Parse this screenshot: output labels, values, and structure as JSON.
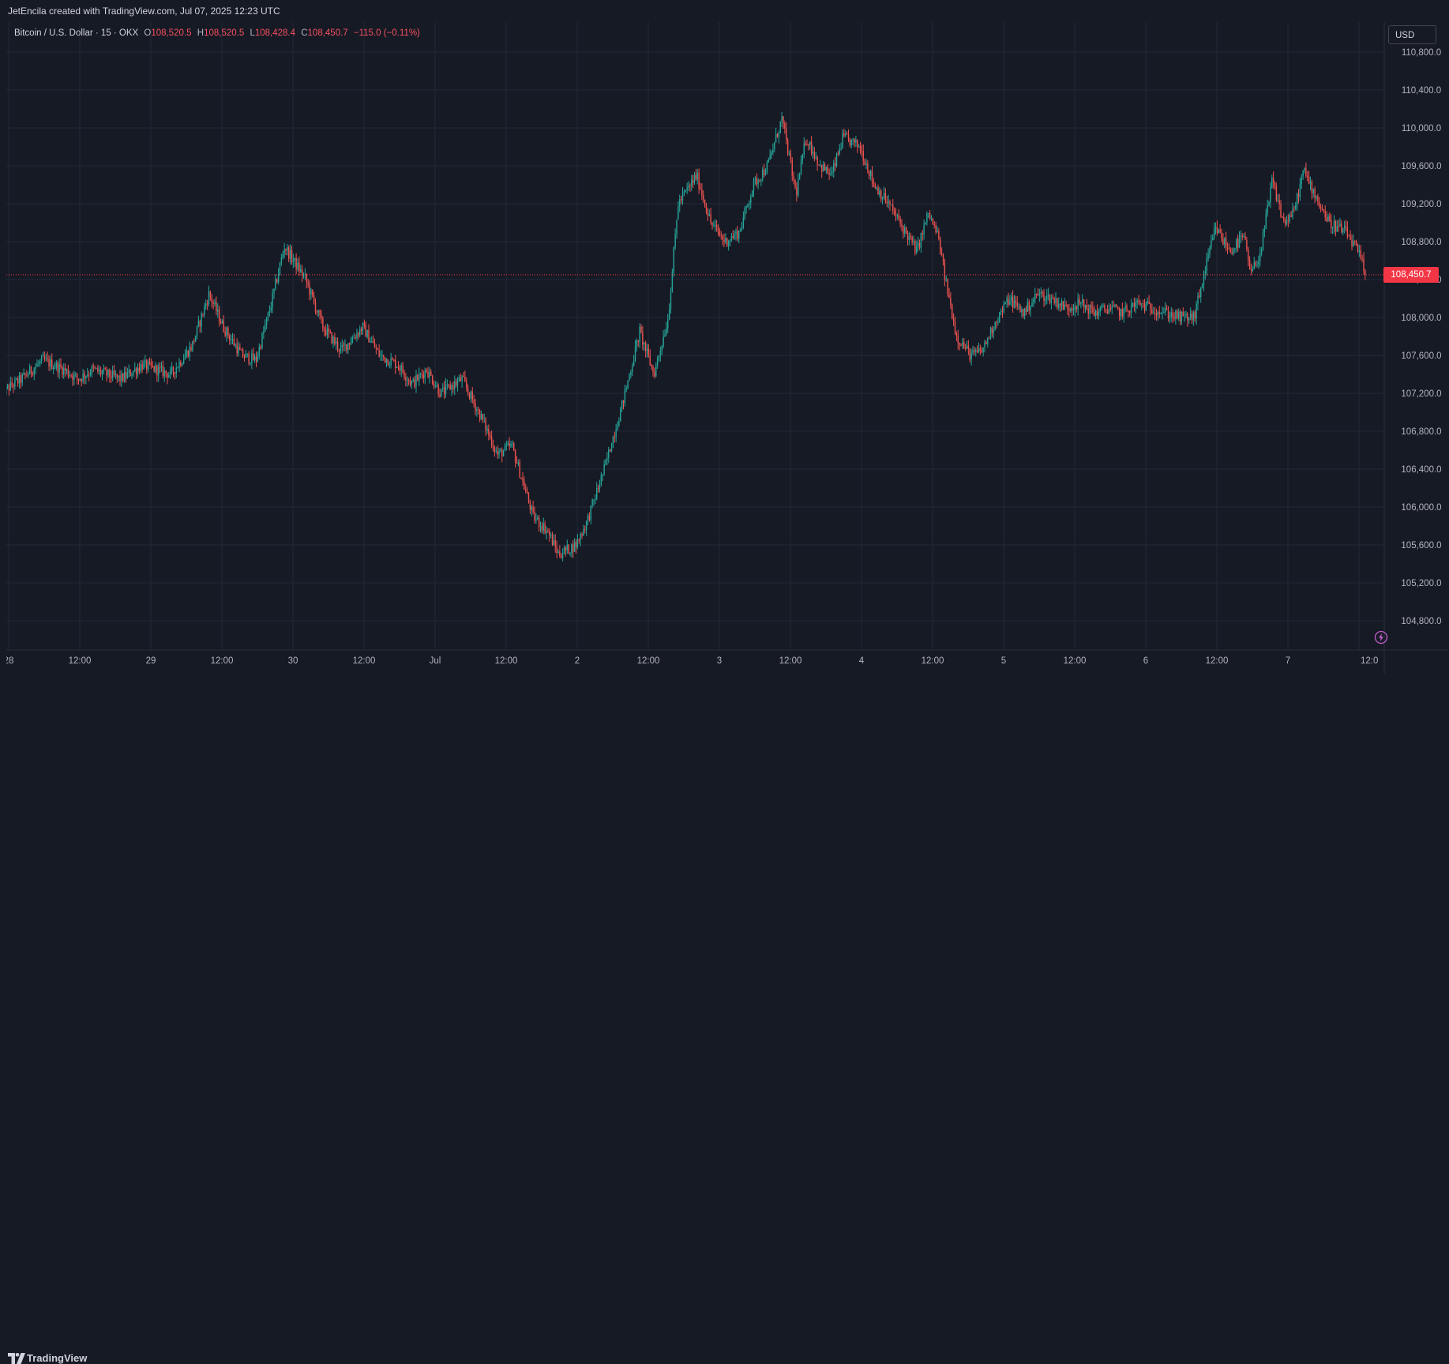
{
  "header": {
    "credit": "JetEncila created with TradingView.com, Jul 07, 2025 12:23 UTC"
  },
  "legend": {
    "symbol": "Bitcoin / U.S. Dollar · 15 · OKX",
    "open_label": "O",
    "open": "108,520.5",
    "high_label": "H",
    "high": "108,520.5",
    "low_label": "L",
    "low": "108,428.4",
    "close_label": "C",
    "close": "108,450.7",
    "change": "−115.0 (−0.11%)"
  },
  "currency": "USD",
  "last_price_label": "108,450.7",
  "footer": {
    "brand": "TradingView"
  },
  "colors": {
    "background": "#161a25",
    "up": "#26a69a",
    "down": "#ef5350",
    "grid": "#232838",
    "price_line": "#f23645",
    "text": "#b2b5be"
  },
  "icons": {
    "alert": "lightning-bolt-icon",
    "logo": "tradingview-logo-icon"
  },
  "chart_data": {
    "type": "candlestick",
    "title": "Bitcoin / U.S. Dollar · 15 · OKX",
    "currency": "USD",
    "last_price": 108450.7,
    "ylim": [
      104600,
      111200
    ],
    "y_ticks": [
      104800,
      105200,
      105600,
      106000,
      106400,
      106800,
      107200,
      107600,
      108000,
      108400,
      108800,
      109200,
      109600,
      110000,
      110400,
      110800
    ],
    "x_ticks": [
      "28",
      "12:00",
      "29",
      "12:00",
      "30",
      "12:00",
      "Jul",
      "12:00",
      "2",
      "12:00",
      "3",
      "12:00",
      "4",
      "12:00",
      "5",
      "12:00",
      "6",
      "12:00",
      "7",
      "12:0"
    ],
    "x_tick_pos": [
      0,
      0.5,
      1,
      1.5,
      2,
      2.5,
      3,
      3.5,
      4,
      4.5,
      5,
      5.5,
      6,
      6.5,
      7,
      7.5,
      8,
      8.5,
      9,
      9.5
    ],
    "bar_interval_minutes": 15,
    "grid": true,
    "path": [
      [
        -0.05,
        107200
      ],
      [
        0.1,
        107350
      ],
      [
        0.25,
        107550
      ],
      [
        0.4,
        107450
      ],
      [
        0.5,
        107350
      ],
      [
        0.6,
        107450
      ],
      [
        0.8,
        107350
      ],
      [
        0.95,
        107500
      ],
      [
        1.15,
        107400
      ],
      [
        1.3,
        107700
      ],
      [
        1.42,
        108250
      ],
      [
        1.52,
        107900
      ],
      [
        1.65,
        107600
      ],
      [
        1.75,
        107550
      ],
      [
        1.85,
        108100
      ],
      [
        1.95,
        108750
      ],
      [
        2.1,
        108400
      ],
      [
        2.22,
        107900
      ],
      [
        2.35,
        107650
      ],
      [
        2.5,
        107900
      ],
      [
        2.62,
        107600
      ],
      [
        2.75,
        107500
      ],
      [
        2.85,
        107300
      ],
      [
        2.95,
        107450
      ],
      [
        3.05,
        107200
      ],
      [
        3.2,
        107350
      ],
      [
        3.35,
        106900
      ],
      [
        3.45,
        106550
      ],
      [
        3.55,
        106650
      ],
      [
        3.62,
        106300
      ],
      [
        3.7,
        105900
      ],
      [
        3.8,
        105750
      ],
      [
        3.88,
        105500
      ],
      [
        4.0,
        105600
      ],
      [
        4.08,
        105850
      ],
      [
        4.2,
        106400
      ],
      [
        4.33,
        107100
      ],
      [
        4.45,
        107850
      ],
      [
        4.55,
        107400
      ],
      [
        4.65,
        108000
      ],
      [
        4.72,
        109200
      ],
      [
        4.85,
        109500
      ],
      [
        4.95,
        109000
      ],
      [
        5.05,
        108800
      ],
      [
        5.15,
        108900
      ],
      [
        5.25,
        109400
      ],
      [
        5.35,
        109600
      ],
      [
        5.45,
        110100
      ],
      [
        5.55,
        109300
      ],
      [
        5.62,
        109900
      ],
      [
        5.72,
        109600
      ],
      [
        5.8,
        109500
      ],
      [
        5.88,
        109900
      ],
      [
        6.0,
        109800
      ],
      [
        6.1,
        109400
      ],
      [
        6.2,
        109200
      ],
      [
        6.3,
        108950
      ],
      [
        6.4,
        108700
      ],
      [
        6.48,
        109100
      ],
      [
        6.55,
        108850
      ],
      [
        6.6,
        108400
      ],
      [
        6.68,
        107800
      ],
      [
        6.78,
        107600
      ],
      [
        6.86,
        107650
      ],
      [
        6.95,
        107950
      ],
      [
        7.05,
        108200
      ],
      [
        7.15,
        108050
      ],
      [
        7.25,
        108250
      ],
      [
        7.35,
        108200
      ],
      [
        7.45,
        108100
      ],
      [
        7.55,
        108150
      ],
      [
        7.65,
        108050
      ],
      [
        7.75,
        108100
      ],
      [
        7.85,
        108050
      ],
      [
        7.95,
        108150
      ],
      [
        8.05,
        108100
      ],
      [
        8.15,
        108050
      ],
      [
        8.25,
        108000
      ],
      [
        8.35,
        108000
      ],
      [
        8.42,
        108450
      ],
      [
        8.5,
        108950
      ],
      [
        8.6,
        108700
      ],
      [
        8.7,
        108850
      ],
      [
        8.75,
        108450
      ],
      [
        8.82,
        108700
      ],
      [
        8.9,
        109450
      ],
      [
        8.98,
        109000
      ],
      [
        9.05,
        109100
      ],
      [
        9.12,
        109550
      ],
      [
        9.2,
        109300
      ],
      [
        9.3,
        109000
      ],
      [
        9.42,
        108900
      ],
      [
        9.5,
        108700
      ],
      [
        9.55,
        108500
      ]
    ]
  }
}
